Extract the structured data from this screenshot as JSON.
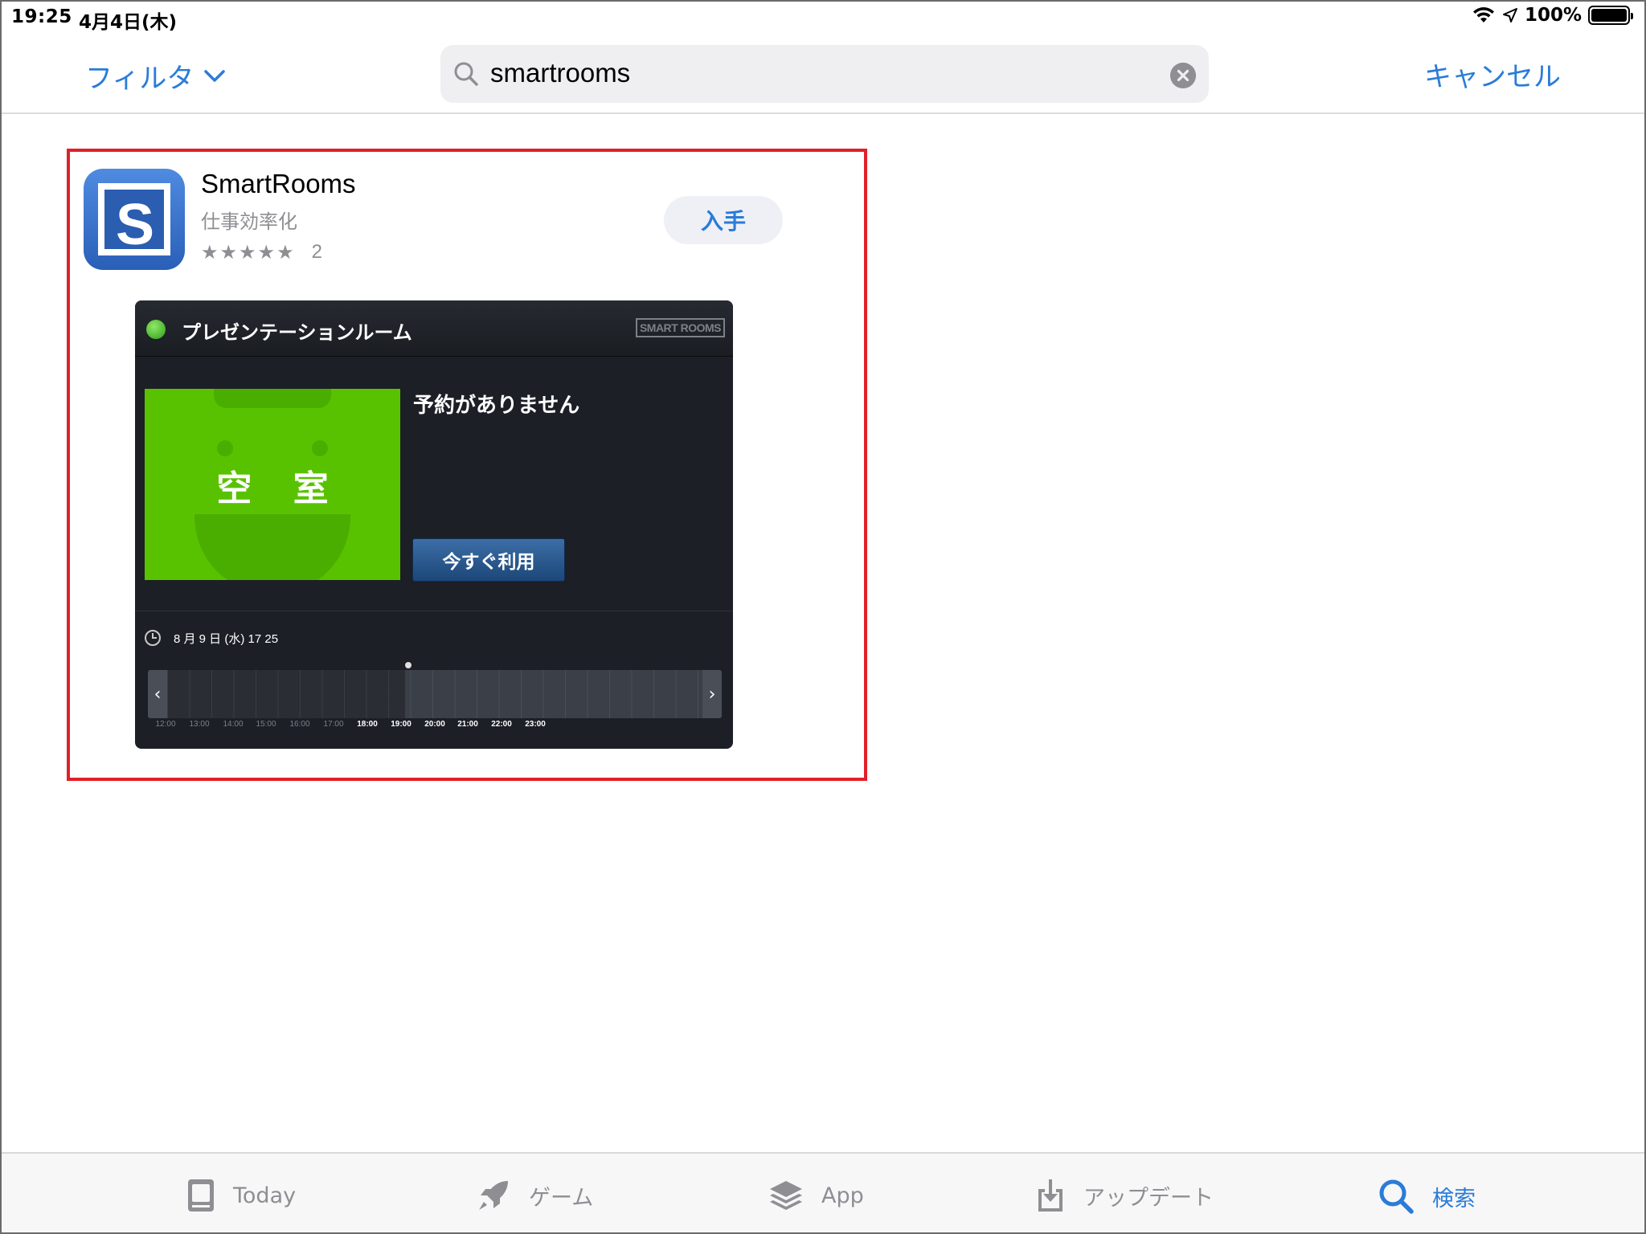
{
  "status_bar": {
    "time": "19:25",
    "date": "4月4日(木)",
    "battery": "100%",
    "battery_level": 1.0
  },
  "nav": {
    "filter_label": "フィルタ",
    "search_value": "smartrooms",
    "cancel_label": "キャンセル"
  },
  "result": {
    "app_name": "SmartRooms",
    "category": "仕事効率化",
    "stars": "★★★★★",
    "rating_count": "2",
    "get_label": "入手"
  },
  "preview": {
    "room_name": "プレゼンテーションルーム",
    "brand": "SMART ROOMS",
    "vacant_label": "空 室",
    "status_message": "予約がありません",
    "use_now_label": "今すぐ利用",
    "datetime": "8 月 9 日 (水) 17  25",
    "ticks_past": [
      "12:00",
      "13:00",
      "14:00",
      "15:00",
      "16:00",
      "17:00"
    ],
    "ticks_future": [
      "18:00",
      "19:00",
      "20:00",
      "21:00",
      "22:00",
      "23:00"
    ]
  },
  "tabs": [
    {
      "label": "Today",
      "icon": "today-icon"
    },
    {
      "label": "ゲーム",
      "icon": "rocket-icon"
    },
    {
      "label": "App",
      "icon": "layers-icon"
    },
    {
      "label": "アップデート",
      "icon": "download-icon"
    },
    {
      "label": "検索",
      "icon": "search-icon"
    }
  ],
  "colors": {
    "accent": "#2a7cd8",
    "highlight": "#e0202a",
    "vacant": "#59c200"
  }
}
